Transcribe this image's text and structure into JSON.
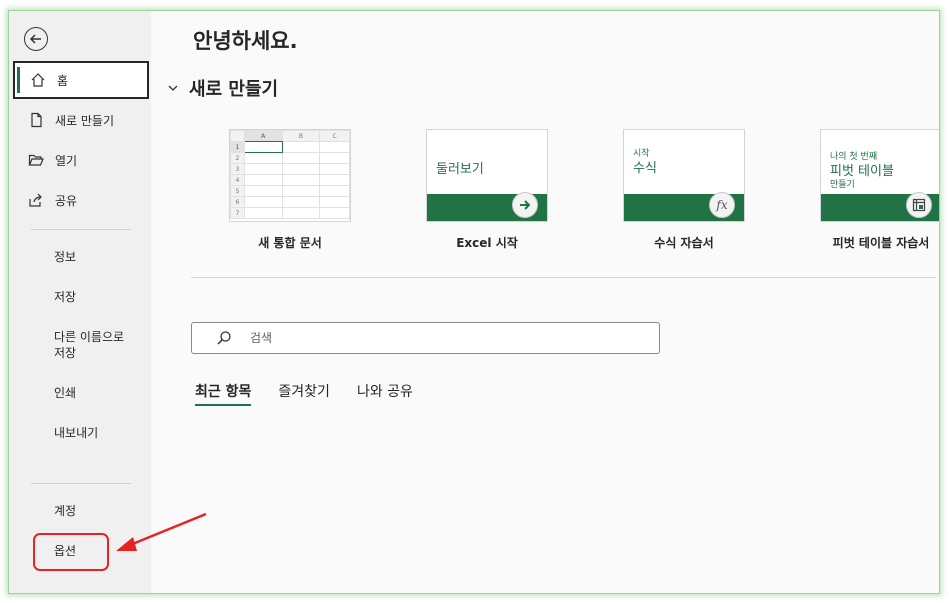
{
  "sidebar": {
    "items": [
      {
        "label": "홈",
        "icon": "home-icon"
      },
      {
        "label": "새로 만들기",
        "icon": "new-document-icon"
      },
      {
        "label": "열기",
        "icon": "folder-open-icon"
      },
      {
        "label": "공유",
        "icon": "share-icon"
      }
    ],
    "text_items": [
      {
        "label": "정보"
      },
      {
        "label": "저장"
      },
      {
        "label": "다른 이름으로 저장"
      },
      {
        "label": "인쇄"
      },
      {
        "label": "내보내기"
      }
    ],
    "bottom_items": [
      {
        "label": "계정"
      },
      {
        "label": "옵션"
      }
    ]
  },
  "main": {
    "greeting": "안녕하세요.",
    "new_section_title": "새로 만들기",
    "templates": [
      {
        "label": "새 통합 문서",
        "grid_cols": [
          "A",
          "B",
          "C"
        ],
        "grid_rows": [
          "1",
          "2",
          "3",
          "4",
          "5",
          "6",
          "7"
        ]
      },
      {
        "label": "Excel 시작",
        "title": "둘러보기"
      },
      {
        "label": "수식 자습서",
        "subtitle": "시작",
        "title": "수식"
      },
      {
        "label": "피벗 테이블 자습서",
        "subtitle": "나의 첫 번째",
        "title": "피벗 테이블",
        "caption": "만들기"
      }
    ],
    "search_placeholder": "검색",
    "tabs": [
      {
        "label": "최근 항목",
        "active": true
      },
      {
        "label": "즐겨찾기",
        "active": false
      },
      {
        "label": "나와 공유",
        "active": false
      }
    ]
  },
  "colors": {
    "accent": "#217346",
    "highlight": "#e62222"
  }
}
